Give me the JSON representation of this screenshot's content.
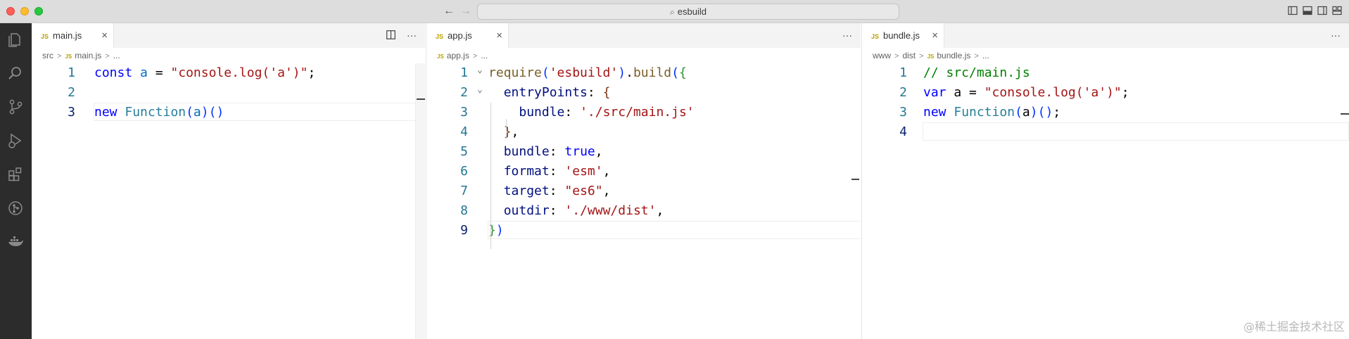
{
  "window": {
    "search_title": "esbuild",
    "nav_back": "←",
    "nav_forward": "→"
  },
  "activity_bar": {
    "items": [
      "explorer-icon",
      "search-icon",
      "source-control-icon",
      "run-debug-icon",
      "extensions-icon",
      "git-graph-icon",
      "docker-icon"
    ]
  },
  "panes": [
    {
      "tab": {
        "badge": "JS",
        "label": "main.js",
        "close": "×"
      },
      "actions": [
        "split-editor-icon",
        "more-icon"
      ],
      "breadcrumb": [
        "src",
        "main.js",
        "..."
      ],
      "line_numbers": [
        "1",
        "2",
        "3"
      ],
      "lines": [
        [
          {
            "t": "const",
            "c": "kw"
          },
          {
            "t": " ",
            "c": "pn"
          },
          {
            "t": "a",
            "c": "var"
          },
          {
            "t": " = ",
            "c": "pn"
          },
          {
            "t": "\"console.log('a')\"",
            "c": "str"
          },
          {
            "t": ";",
            "c": "pn"
          }
        ],
        [],
        [
          {
            "t": "new",
            "c": "kw"
          },
          {
            "t": " ",
            "c": "pn"
          },
          {
            "t": "Function",
            "c": "cls"
          },
          {
            "t": "(",
            "c": "br1"
          },
          {
            "t": "a",
            "c": "var"
          },
          {
            "t": ")",
            "c": "br1"
          },
          {
            "t": "(",
            "c": "br1"
          },
          {
            "t": ")",
            "c": "br1"
          }
        ]
      ],
      "active_line": 3
    },
    {
      "tab": {
        "badge": "JS",
        "label": "app.js",
        "close": "×"
      },
      "actions": [
        "more-icon"
      ],
      "breadcrumb": [
        "app.js",
        "..."
      ],
      "line_numbers": [
        "1",
        "2",
        "3",
        "4",
        "5",
        "6",
        "7",
        "8",
        "9"
      ],
      "lines": [
        [
          {
            "t": "require",
            "c": "fn"
          },
          {
            "t": "(",
            "c": "br1"
          },
          {
            "t": "'esbuild'",
            "c": "str"
          },
          {
            "t": ")",
            "c": "br1"
          },
          {
            "t": ".",
            "c": "pn"
          },
          {
            "t": "build",
            "c": "fn"
          },
          {
            "t": "(",
            "c": "br1"
          },
          {
            "t": "{",
            "c": "br2"
          }
        ],
        [
          {
            "t": "  ",
            "c": "pn"
          },
          {
            "t": "entryPoints",
            "c": "prop"
          },
          {
            "t": ": ",
            "c": "pn"
          },
          {
            "t": "{",
            "c": "br3"
          }
        ],
        [
          {
            "t": "    ",
            "c": "pn"
          },
          {
            "t": "bundle",
            "c": "prop"
          },
          {
            "t": ": ",
            "c": "pn"
          },
          {
            "t": "'./src/main.js'",
            "c": "str"
          }
        ],
        [
          {
            "t": "  ",
            "c": "pn"
          },
          {
            "t": "}",
            "c": "br3"
          },
          {
            "t": ",",
            "c": "pn"
          }
        ],
        [
          {
            "t": "  ",
            "c": "pn"
          },
          {
            "t": "bundle",
            "c": "prop"
          },
          {
            "t": ": ",
            "c": "pn"
          },
          {
            "t": "true",
            "c": "kw"
          },
          {
            "t": ",",
            "c": "pn"
          }
        ],
        [
          {
            "t": "  ",
            "c": "pn"
          },
          {
            "t": "format",
            "c": "prop"
          },
          {
            "t": ": ",
            "c": "pn"
          },
          {
            "t": "'esm'",
            "c": "str"
          },
          {
            "t": ",",
            "c": "pn"
          }
        ],
        [
          {
            "t": "  ",
            "c": "pn"
          },
          {
            "t": "target",
            "c": "prop"
          },
          {
            "t": ": ",
            "c": "pn"
          },
          {
            "t": "\"es6\"",
            "c": "str"
          },
          {
            "t": ",",
            "c": "pn"
          }
        ],
        [
          {
            "t": "  ",
            "c": "pn"
          },
          {
            "t": "outdir",
            "c": "prop"
          },
          {
            "t": ": ",
            "c": "pn"
          },
          {
            "t": "'./www/dist'",
            "c": "str"
          },
          {
            "t": ",",
            "c": "pn"
          }
        ],
        [
          {
            "t": "}",
            "c": "br2"
          },
          {
            "t": ")",
            "c": "br1"
          }
        ]
      ],
      "active_line": 9
    },
    {
      "tab": {
        "badge": "JS",
        "label": "bundle.js",
        "close": "×"
      },
      "actions": [
        "more-icon"
      ],
      "breadcrumb": [
        "www",
        "dist",
        "bundle.js",
        "..."
      ],
      "line_numbers": [
        "1",
        "2",
        "3",
        "4"
      ],
      "lines": [
        [
          {
            "t": "// src/main.js",
            "c": "cm"
          }
        ],
        [
          {
            "t": "var",
            "c": "kw"
          },
          {
            "t": " a = ",
            "c": "pn"
          },
          {
            "t": "\"console.log('a')\"",
            "c": "str"
          },
          {
            "t": ";",
            "c": "pn"
          }
        ],
        [
          {
            "t": "new",
            "c": "kw"
          },
          {
            "t": " ",
            "c": "pn"
          },
          {
            "t": "Function",
            "c": "cls"
          },
          {
            "t": "(",
            "c": "br1"
          },
          {
            "t": "a",
            "c": "pn"
          },
          {
            "t": ")",
            "c": "br1"
          },
          {
            "t": "(",
            "c": "br1"
          },
          {
            "t": ")",
            "c": "br1"
          },
          {
            "t": ";",
            "c": "pn"
          }
        ],
        []
      ],
      "active_line": 4
    }
  ],
  "watermark": "@稀土掘金技术社区"
}
